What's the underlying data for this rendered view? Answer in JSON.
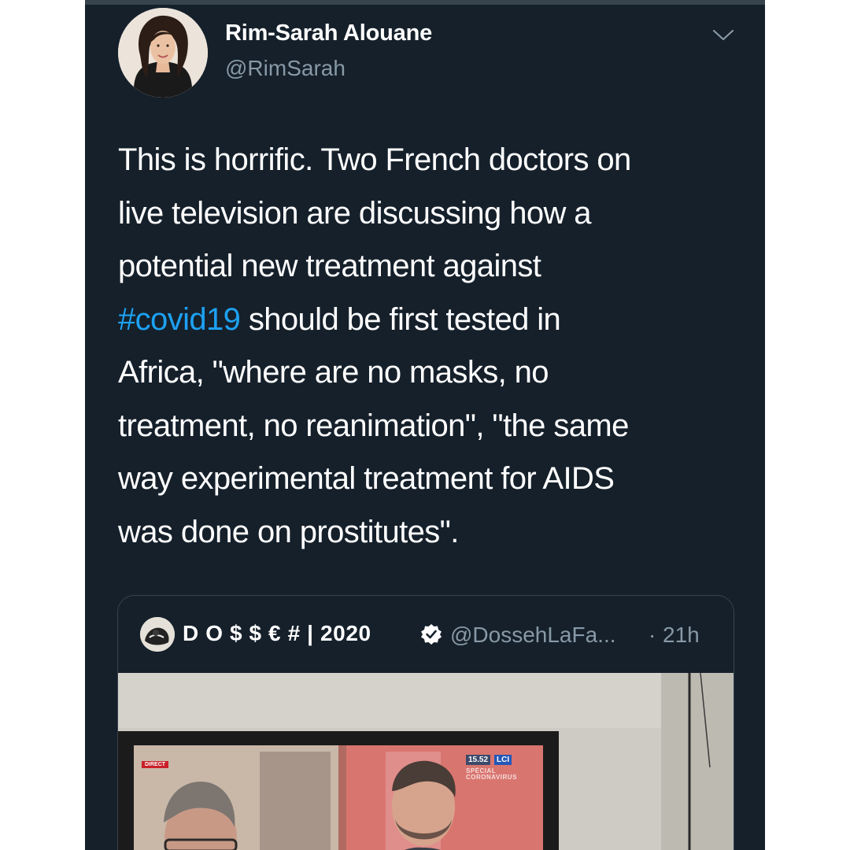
{
  "tweet": {
    "author_name": "Rim-Sarah Alouane",
    "author_handle": "@RimSarah",
    "text_lines": [
      {
        "text": "This is horrific. Two French doctors on"
      },
      {
        "text": "live television are discussing how a"
      },
      {
        "text": "potential new treatment against"
      },
      {
        "hashtag": "#covid19",
        "text": " should be first tested in"
      },
      {
        "text": "Africa, \"where are no masks, no"
      },
      {
        "text": "treatment, no reanimation\", \"the same"
      },
      {
        "text": "way experimental treatment for AIDS"
      },
      {
        "text": "was done on prostitutes\"."
      }
    ]
  },
  "quoted_tweet": {
    "author_name": "D O $ $ € # | 2020",
    "verified": true,
    "author_handle": "@DossehLaFa...",
    "separator": "·",
    "time": "21h",
    "media": {
      "tv_direct": "DIRECT",
      "tv_clock": "15.52",
      "tv_channel": "LCI",
      "tv_ticker_1": "SPÉCIAL",
      "tv_ticker_2": "CORONAVIRUS"
    }
  },
  "icons": {
    "menu": "chevron-down-icon",
    "verified": "verified-badge-icon"
  },
  "colors": {
    "background": "#15202b",
    "text": "#ffffff",
    "secondary_text": "#8899a6",
    "hashtag": "#1da1f2",
    "border": "#38444d"
  }
}
